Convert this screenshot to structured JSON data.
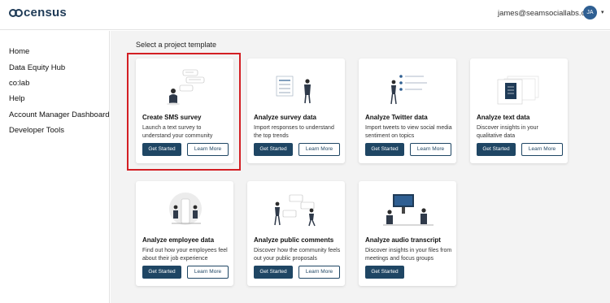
{
  "header": {
    "logo_text": "census",
    "user_email": "james@seamsociallabs.com",
    "avatar_initials": "JA",
    "menu_caret": "▾"
  },
  "sidebar": {
    "items": [
      {
        "label": "Home"
      },
      {
        "label": "Data Equity Hub"
      },
      {
        "label": "co:lab"
      },
      {
        "label": "Help"
      },
      {
        "label": "Account Manager Dashboard"
      },
      {
        "label": "Developer Tools"
      }
    ]
  },
  "main": {
    "section_title": "Select a project template",
    "cards": [
      {
        "title": "Create SMS survey",
        "description": "Launch a text survey to understand your community",
        "primary": "Get Started",
        "secondary": "Learn More",
        "icon": "sms-survey-illustration",
        "selected": true
      },
      {
        "title": "Analyze survey data",
        "description": "Import responses to understand the top trends",
        "primary": "Get Started",
        "secondary": "Learn More",
        "icon": "survey-data-illustration"
      },
      {
        "title": "Analyze Twitter data",
        "description": "Import tweets to view social media sentiment on topics",
        "primary": "Get Started",
        "secondary": "Learn More",
        "icon": "twitter-data-illustration"
      },
      {
        "title": "Analyze text data",
        "description": "Discover insights in your qualitative data",
        "primary": "Get Started",
        "secondary": "Learn More",
        "icon": "text-data-illustration"
      },
      {
        "title": "Analyze employee data",
        "description": "Find out how your employees feel about their job experience",
        "primary": "Get Started",
        "secondary": "Learn More",
        "icon": "employee-data-illustration"
      },
      {
        "title": "Analyze public comments",
        "description": "Discover how the community feels out your public proposals",
        "primary": "Get Started",
        "secondary": "Learn More",
        "icon": "public-comments-illustration"
      },
      {
        "title": "Analyze audio transcript",
        "description": "Discover insights in your files from meetings and focus groups",
        "primary": "Get Started",
        "icon": "audio-transcript-illustration"
      }
    ]
  },
  "colors": {
    "brand": "#1f3b57",
    "primary_button": "#1f4664",
    "highlight": "#d31f24",
    "background": "#f3f3f3"
  }
}
